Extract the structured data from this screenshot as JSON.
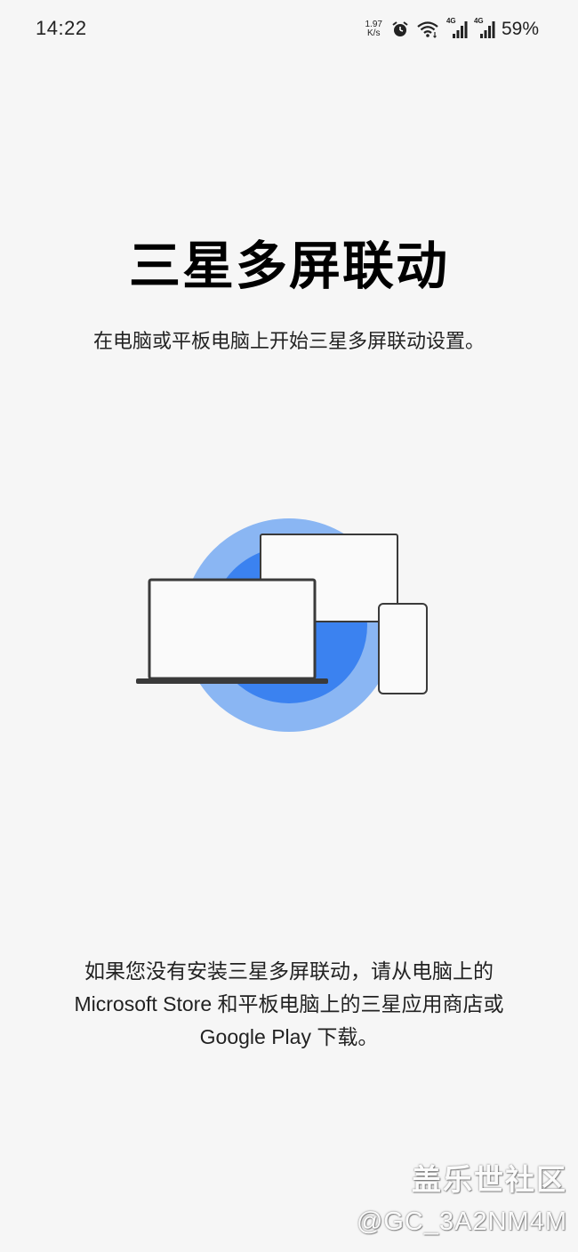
{
  "status_bar": {
    "time": "14:22",
    "net_speed_value": "1.97",
    "net_speed_unit": "K/s",
    "signal1_label": "4G",
    "signal2_label": "4G",
    "battery": "59%",
    "icons": [
      "alarm-icon",
      "wifi-icon",
      "signal-icon",
      "signal-icon"
    ]
  },
  "main": {
    "title": "三星多屏联动",
    "subtitle": "在电脑或平板电脑上开始三星多屏联动设置。",
    "illustration_icons": [
      "laptop-icon",
      "monitor-icon",
      "phone-icon"
    ],
    "note_lines": [
      "如果您没有安装三星多屏联动，请从电脑上的",
      "Microsoft Store 和平板电脑上的三星应用商店或",
      "Google Play 下载。"
    ]
  },
  "watermark": {
    "brand": "盖乐世社区",
    "handle": "@GC_3A2NM4M"
  },
  "colors": {
    "background": "#f6f6f6",
    "circle_outer": "#8ab6f3",
    "circle_inner": "#3b82f0",
    "device_fill": "#fafafa",
    "device_stroke": "#3a3a3a"
  }
}
